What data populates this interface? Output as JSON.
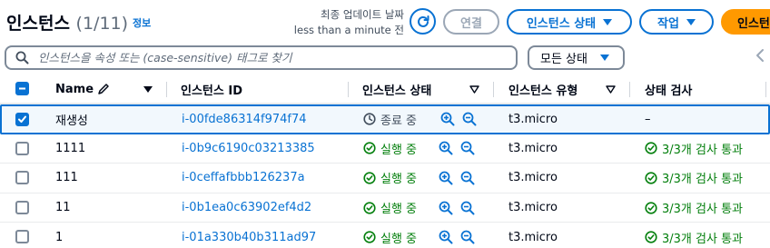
{
  "header": {
    "title": "인스턴스",
    "count": "(1/11)",
    "info_link": "정보",
    "last_updated_line1": "최종 업데이트 날짜",
    "last_updated_line2": "less than a minute 전",
    "connect_label": "연결",
    "instance_state_label": "인스턴스 상태",
    "actions_label": "작업",
    "launch_label": "인스턴"
  },
  "filter": {
    "search_placeholder": "인스턴스을 속성 또는 (case-sensitive) 태그로 찾기",
    "state_filter_label": "모든 상태"
  },
  "table": {
    "columns": {
      "name": "Name",
      "instance_id": "인스턴스 ID",
      "instance_state": "인스턴스 상태",
      "instance_type": "인스턴스 유형",
      "status_check": "상태 검사"
    },
    "rows": [
      {
        "name": "재생성",
        "id": "i-00fde86314f974f74",
        "state": "종료 중",
        "type": "t3.micro",
        "check": "–",
        "selected": true
      },
      {
        "name": "1111",
        "id": "i-0b9c6190c03213385",
        "state": "실행 중",
        "type": "t3.micro",
        "check": "3/3개 검사 통과",
        "selected": false
      },
      {
        "name": "111",
        "id": "i-0ceffafbbb126237a",
        "state": "실행 중",
        "type": "t3.micro",
        "check": "3/3개 검사 통과",
        "selected": false
      },
      {
        "name": "11",
        "id": "i-0b1ea0c63902ef4d2",
        "state": "실행 중",
        "type": "t3.micro",
        "check": "3/3개 검사 통과",
        "selected": false
      },
      {
        "name": "1",
        "id": "i-01a330b40b311ad97",
        "state": "실행 중",
        "type": "t3.micro",
        "check": "3/3개 검사 통과",
        "selected": false
      }
    ]
  },
  "colors": {
    "accent": "#0972d3",
    "success": "#037f0c",
    "primary_button": "#ff9900",
    "disabled": "#9ba7b6"
  }
}
